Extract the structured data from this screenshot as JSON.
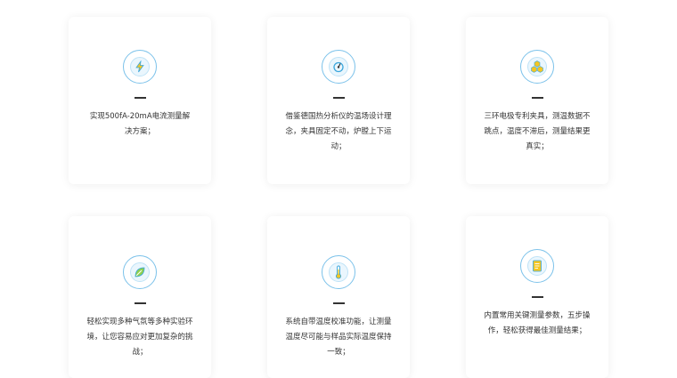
{
  "features": [
    {
      "icon": "lightning-icon",
      "text": "实现500fA-20mA电流测量解决方案；"
    },
    {
      "icon": "gauge-icon",
      "text": "借鉴德国热分析仪的温场设计理念，夹具固定不动，炉膛上下运动；"
    },
    {
      "icon": "hexagon-cluster-icon",
      "text": "三环电极专利夹具，测温数据不跳点，温度不滞后，测量结果更真实；"
    },
    {
      "icon": "leaf-icon",
      "text": "轻松实现多种气氛等多种实验环境，让您容易应对更加复杂的挑战；"
    },
    {
      "icon": "thermometer-icon",
      "text": "系统自带温度校准功能，让测量温度尽可能与样品实际温度保持一致；"
    },
    {
      "icon": "document-icon",
      "text": "内置常用关键测量参数，五步操作，轻松获得最佳测量结果；"
    }
  ],
  "colors": {
    "accent": "#3aa6dc",
    "accent_light": "#eaf6fd"
  }
}
